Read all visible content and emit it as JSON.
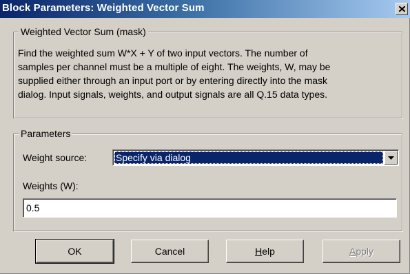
{
  "window": {
    "title": "Block Parameters: Weighted Vector Sum"
  },
  "description": {
    "legend": "Weighted Vector Sum (mask)",
    "lines": [
      "Find the weighted sum W*X + Y of two input vectors. The number of",
      "samples per channel must be a multiple of eight. The weights, W, may be",
      "supplied either through an input port or by entering directly into the mask",
      "dialog. Input signals, weights, and output signals are all Q.15 data types."
    ]
  },
  "parameters": {
    "legend": "Parameters",
    "weight_source": {
      "label": "Weight source:",
      "selected": "Specify via dialog"
    },
    "weights": {
      "label": "Weights (W):",
      "value": "0.5"
    }
  },
  "buttons": {
    "ok": "OK",
    "cancel": "Cancel",
    "help_prefix": "",
    "help_mnemonic": "H",
    "help_rest": "elp",
    "apply_mnemonic": "A",
    "apply_rest": "pply"
  },
  "colors": {
    "titlebar_start": "#0a246a",
    "titlebar_end": "#a6caf0",
    "face": "#d4d0c8",
    "selection": "#0a246a"
  },
  "icons": {
    "close": "close-icon",
    "dropdown": "chevron-down-icon"
  }
}
